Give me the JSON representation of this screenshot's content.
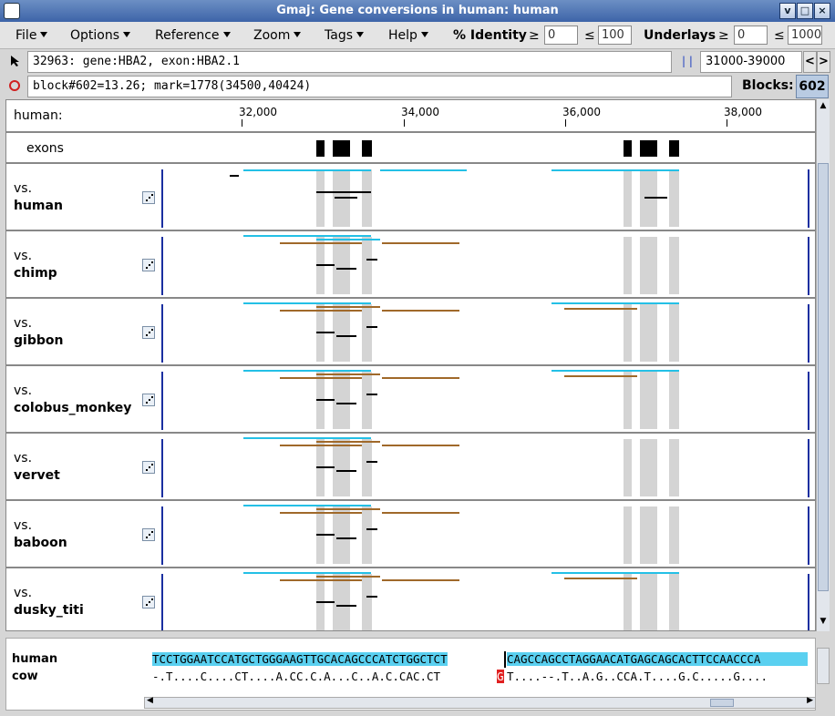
{
  "window": {
    "title": "Gmaj: Gene conversions in human: human",
    "buttons": [
      "v",
      "□",
      "×"
    ]
  },
  "menu": {
    "items": [
      "File",
      "Options",
      "Reference",
      "Zoom",
      "Tags",
      "Help"
    ],
    "identity_label": "% Identity",
    "identity_ge": "≥",
    "identity_min": "0",
    "identity_le": "≤",
    "identity_max": "100",
    "underlays_label": "Underlays",
    "underlays_ge": "≥",
    "underlays_min": "0",
    "underlays_le": "≤",
    "underlays_max": "1000"
  },
  "info": {
    "mark_text": "32963: gene:HBA2, exon:HBA2.1",
    "block_text": "block#602=13.26; mark=1778(34500,40424)",
    "range_icon": "| |",
    "range": "31000-39000",
    "prev": "<",
    "next": ">",
    "blocks_label": "Blocks:",
    "blocks_value": "602"
  },
  "ruler": {
    "species": "human:",
    "ticks": [
      "32,000",
      "34,000",
      "36,000",
      "38,000"
    ]
  },
  "exons_label": "exons",
  "rows": [
    {
      "vs": "vs.",
      "name": "human"
    },
    {
      "vs": "vs.",
      "name": "chimp"
    },
    {
      "vs": "vs.",
      "name": "gibbon"
    },
    {
      "vs": "vs.",
      "name": "colobus_monkey"
    },
    {
      "vs": "vs.",
      "name": "vervet"
    },
    {
      "vs": "vs.",
      "name": "baboon"
    },
    {
      "vs": "vs.",
      "name": "dusky_titi"
    }
  ],
  "alignment": {
    "ref_name": "human",
    "ref_seq_a": "TCCTGGAATCCATGCTGGGAAGTTGCACAGCCCATCTGGCTCT",
    "ref_seq_b": "CAGCCAGCCTAGGAACATGAGCAGCACTTCCAACCCA",
    "other_name": "cow",
    "other_seq_a": "-.T....C....CT....A.CC.C.A...C..A.C.CAC.CT",
    "other_seq_hl": "G",
    "other_seq_b": "T....--.T..A.G..CCA.T....G.C.....G...."
  },
  "colors": {
    "highlight": "#5ad0f0",
    "cyan": "#24c0e6",
    "brown": "#a0692a",
    "mismatch": "#e02020"
  }
}
